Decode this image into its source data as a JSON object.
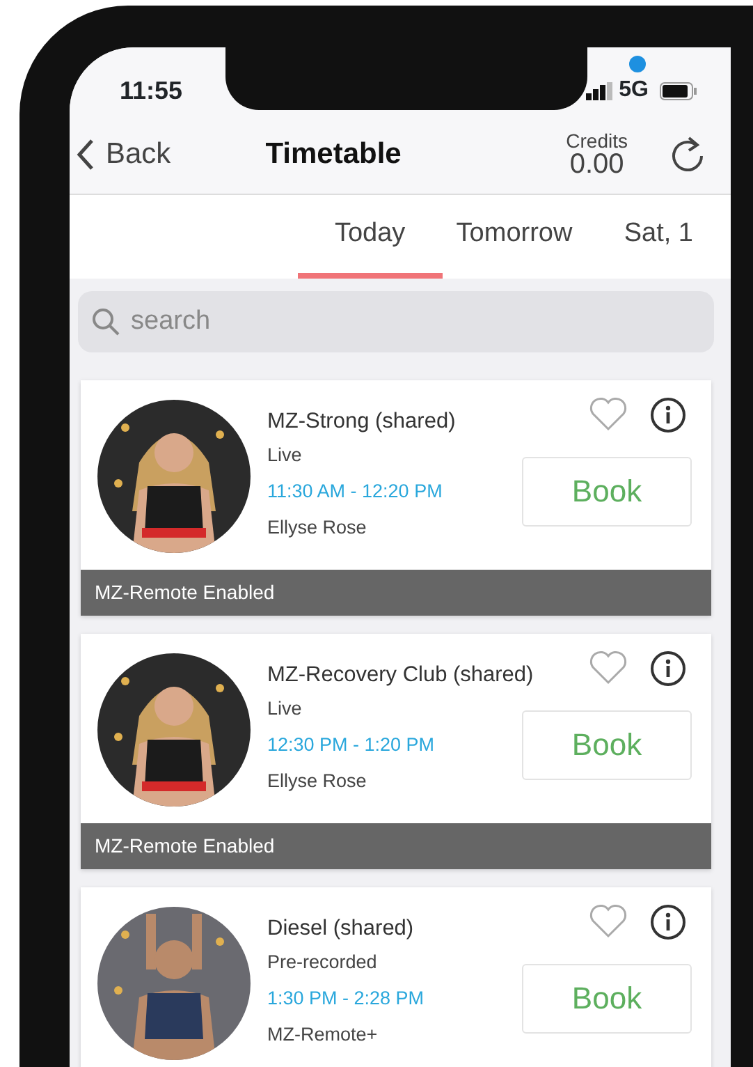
{
  "status_bar": {
    "time": "11:55",
    "network": "5G"
  },
  "header": {
    "back": "Back",
    "title": "Timetable",
    "credits_label": "Credits",
    "credits_value": "0.00"
  },
  "tabs": [
    {
      "label": "Today",
      "selected": true
    },
    {
      "label": "Tomorrow",
      "selected": false
    },
    {
      "label": "Sat, 1",
      "selected": false
    }
  ],
  "search": {
    "placeholder": "search"
  },
  "classes": [
    {
      "title": "MZ-Strong (shared)",
      "type": "Live",
      "time": "11:30 AM - 12:20 PM",
      "instructor": "Ellyse Rose",
      "favorite": false,
      "button": "Book",
      "footer": "MZ-Remote Enabled"
    },
    {
      "title": "MZ-Recovery Club (shared)",
      "type": "Live",
      "time": "12:30 PM - 1:20 PM",
      "instructor": "Ellyse Rose",
      "favorite": false,
      "button": "Book",
      "footer": "MZ-Remote Enabled"
    },
    {
      "title": "Diesel (shared)",
      "type": "Pre-recorded",
      "time": "1:30 PM - 2:28 PM",
      "instructor": "MZ-Remote+",
      "favorite": false,
      "button": "Book"
    }
  ]
}
